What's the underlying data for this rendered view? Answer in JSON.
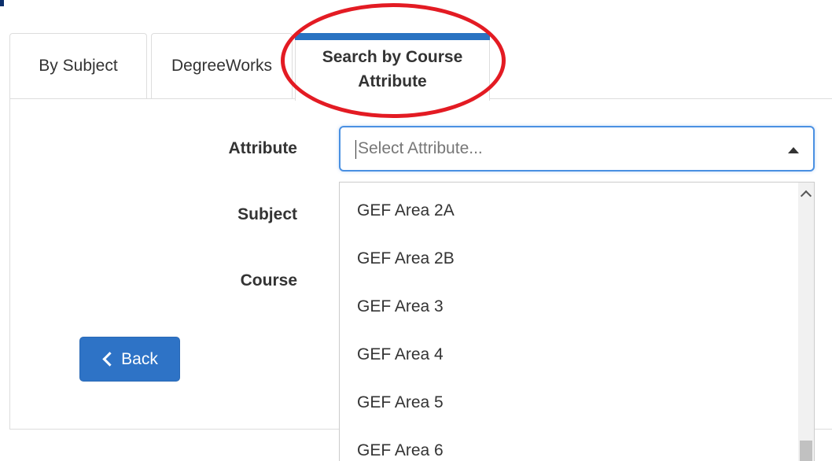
{
  "tabs": [
    {
      "label": "By Subject"
    },
    {
      "label": "DegreeWorks"
    },
    {
      "label": "Search by Course Attribute"
    }
  ],
  "form": {
    "attribute_label": "Attribute",
    "subject_label": "Subject",
    "course_label": "Course",
    "attribute_placeholder": "Select Attribute..."
  },
  "dropdown": {
    "options": [
      "GEF Area 2A",
      "GEF Area 2B",
      "GEF Area 3",
      "GEF Area 4",
      "GEF Area 5",
      "GEF Area 6"
    ]
  },
  "buttons": {
    "back_label": "Back"
  },
  "colors": {
    "active_tab_accent": "#2a73c2",
    "back_button": "#2e73c6",
    "highlight_annotation": "#e31b23"
  },
  "icons": {
    "back": "chevron-left-icon",
    "select": "caret-up-icon",
    "scroll_up": "chevron-up-icon"
  }
}
